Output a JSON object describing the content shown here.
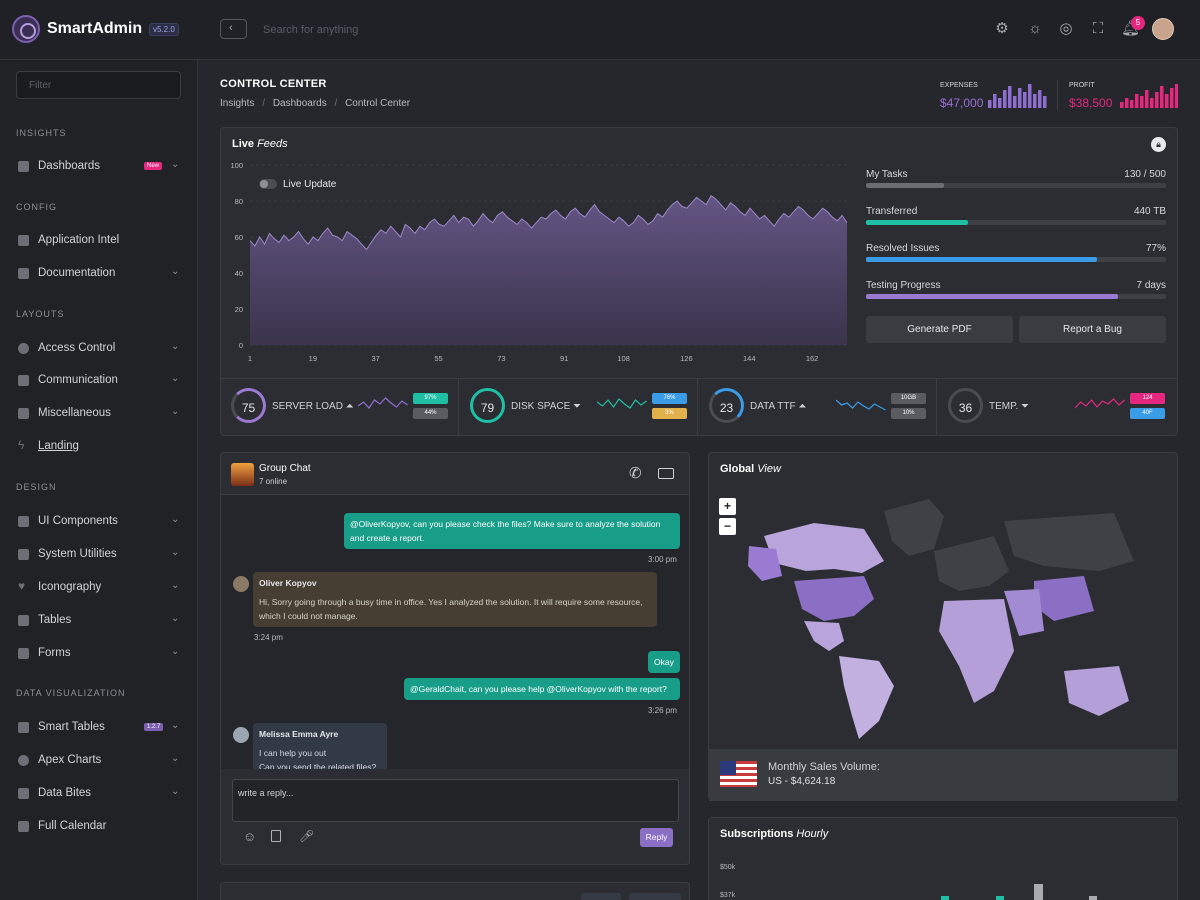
{
  "header": {
    "app_name": "SmartAdmin",
    "version": "v5.2.0",
    "search_placeholder": "Search for anything",
    "notification_count": "5",
    "icons": [
      "gear-icon",
      "sun-icon",
      "theme-icon",
      "fullscreen-icon",
      "bell-icon"
    ]
  },
  "sidebar": {
    "filter_placeholder": "Filter",
    "sections": {
      "insights": "INSIGHTS",
      "config": "CONFIG",
      "layouts": "LAYOUTS",
      "design": "DESIGN",
      "dataviz": "DATA VISUALIZATION"
    },
    "items": [
      {
        "label": "Dashboards",
        "badge": "New"
      },
      {
        "label": "Application Intel"
      },
      {
        "label": "Documentation"
      },
      {
        "label": "Access Control"
      },
      {
        "label": "Communication"
      },
      {
        "label": "Miscellaneous"
      },
      {
        "label": "Landing"
      },
      {
        "label": "UI Components"
      },
      {
        "label": "System Utilities"
      },
      {
        "label": "Iconography"
      },
      {
        "label": "Tables"
      },
      {
        "label": "Forms"
      },
      {
        "label": "Smart Tables",
        "badge": "1.2.7"
      },
      {
        "label": "Apex Charts"
      },
      {
        "label": "Data Bites"
      },
      {
        "label": "Full Calendar"
      }
    ]
  },
  "page": {
    "title": "CONTROL CENTER",
    "breadcrumb": [
      "Insights",
      "Dashboards",
      "Control Center"
    ],
    "expenses": {
      "label": "EXPENSES",
      "value": "$47,000",
      "color": "#9b6fd6"
    },
    "profit": {
      "label": "PROFIT",
      "value": "$38,500",
      "color": "#e6277f"
    }
  },
  "live_feeds": {
    "title_bold": "Live",
    "title_italic": "Feeds",
    "toggle_label": "Live Update",
    "y_ticks": [
      "100",
      "80",
      "60",
      "40",
      "20",
      "0"
    ],
    "x_ticks": [
      "1",
      "19",
      "37",
      "55",
      "73",
      "91",
      "108",
      "126",
      "144",
      "162"
    ],
    "series": [
      58,
      55,
      60,
      56,
      62,
      59,
      57,
      61,
      58,
      60,
      63,
      59,
      56,
      60,
      58,
      62,
      65,
      61,
      60,
      58,
      63,
      61,
      59,
      56,
      53,
      57,
      61,
      64,
      62,
      66,
      63,
      60,
      67,
      65,
      62,
      66,
      64,
      68,
      70,
      67,
      66,
      69,
      72,
      68,
      71,
      70,
      66,
      69,
      73,
      70,
      68,
      72,
      74,
      71,
      69,
      67,
      70,
      68,
      65,
      68,
      71,
      70,
      73,
      75,
      72,
      70,
      74,
      76,
      73,
      71,
      75,
      78,
      74,
      72,
      70,
      68,
      71,
      69,
      66,
      68,
      72,
      70,
      67,
      69,
      73,
      71,
      75,
      78,
      80,
      77,
      76,
      79,
      82,
      80,
      78,
      83,
      81,
      78,
      75,
      79,
      77,
      74,
      72,
      76,
      73,
      70,
      72,
      69,
      66,
      70,
      73,
      71,
      74,
      77,
      75,
      72,
      70,
      73,
      76,
      74,
      71,
      69,
      72,
      68
    ],
    "tasks": [
      {
        "label": "My Tasks",
        "value": "130 / 500",
        "fraction": 0.26,
        "color": "#6b6d73"
      },
      {
        "label": "Transferred",
        "value": "440 TB",
        "fraction": 0.34,
        "color": "#1fbfa6"
      },
      {
        "label": "Resolved Issues",
        "value": "77%",
        "fraction": 0.77,
        "color": "#3a9ce6"
      },
      {
        "label": "Testing Progress",
        "value": "7 days",
        "fraction": 0.84,
        "color": "#9b7ad1"
      }
    ],
    "buttons": [
      "Generate PDF",
      "Report a Bug"
    ],
    "stats": [
      {
        "value": "75",
        "label": "SERVER LOAD",
        "trend": "up",
        "ring_color": "#9b7ad1",
        "line_color": "#8e6fd0",
        "pill_top": "97%",
        "pill_top_color": "#1fbfa6",
        "pill_bottom": "44%",
        "pill_bottom_color": "#5a5c62"
      },
      {
        "value": "79",
        "label": "DISK SPACE",
        "trend": "down",
        "ring_color": "#1fbfa6",
        "line_color": "#1fbfa6",
        "pill_top": "76%",
        "pill_top_color": "#3a9ce6",
        "pill_bottom": "3%",
        "pill_bottom_color": "#e1b24b"
      },
      {
        "value": "23",
        "label": "DATA TTF",
        "trend": "up",
        "ring_color": "#3a9ce6",
        "line_color": "#3a9ce6",
        "pill_top": "10GB",
        "pill_top_color": "#5a5c62",
        "pill_bottom": "10%",
        "pill_bottom_color": "#5a5c62"
      },
      {
        "value": "36",
        "label": "TEMP.",
        "trend": "down",
        "ring_color": "#4a4c52",
        "line_color": "#e6277f",
        "pill_top": "124",
        "pill_top_color": "#e6277f",
        "pill_bottom": "40F",
        "pill_bottom_color": "#3a9ce6"
      }
    ]
  },
  "chat": {
    "title": "Group Chat",
    "online": "7 online",
    "messages": [
      {
        "side": "right",
        "text": "@OliverKopyov, can you please check the files? Make sure to analyze the solution and create a report.",
        "time": "3:00 pm"
      },
      {
        "side": "left",
        "name": "Oliver Kopyov",
        "text": "Hi, Sorry going through a busy time in office. Yes I analyzed the solution. It will require some resource, which I could not manage.",
        "time": "3:24 pm"
      },
      {
        "side": "right",
        "text": "Okay"
      },
      {
        "side": "right",
        "text": "@GeraldChait, can you please help @OliverKopyov with the report?",
        "time": "3:26 pm"
      },
      {
        "side": "left",
        "name": "Melissa Emma Ayre",
        "text": "I can help you out",
        "text2": "Can you send the related files?"
      }
    ],
    "reply_placeholder": "write a reply...",
    "reply_button": "Reply"
  },
  "global_view": {
    "title_bold": "Global",
    "title_italic": "View",
    "zoom_in": "+",
    "zoom_out": "−",
    "footer_title": "Monthly Sales Volume:",
    "footer_value": "US - $4,624.18"
  },
  "subscriptions": {
    "title_bold": "Subscriptions",
    "title_italic": "Hourly",
    "y_ticks": [
      "$50k",
      "$37k"
    ]
  },
  "colors": {
    "accent_purple": "#9b7ad1",
    "teal": "#1fbfa6",
    "pink": "#e6277f",
    "blue": "#3a9ce6"
  }
}
